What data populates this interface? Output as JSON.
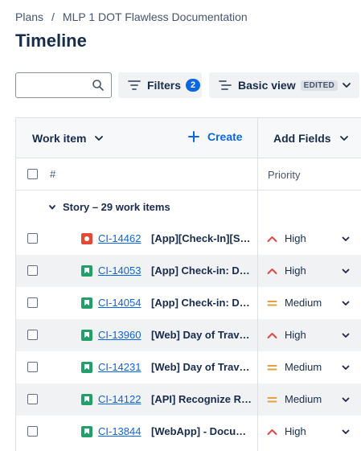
{
  "breadcrumb": {
    "root": "Plans",
    "separator": "/",
    "plan": "MLP 1 DOT Flawless Documentation"
  },
  "title": "Timeline",
  "toolbar": {
    "search_value": "",
    "filters_label": "Filters",
    "filters_count": "2",
    "view_label": "Basic view",
    "view_badge": "EDITED"
  },
  "grid": {
    "work_item_header": "Work item",
    "create_label": "Create",
    "add_fields_label": "Add Fields",
    "number_header": "#",
    "priority_header": "Priority",
    "group_label": "Story – 29 work items"
  },
  "rows": [
    {
      "type": "bug",
      "key": "CI-14462",
      "summary": "[App][Check-In][S…",
      "priority": "High"
    },
    {
      "type": "story",
      "key": "CI-14053",
      "summary": "[App] Check-in: D…",
      "priority": "High"
    },
    {
      "type": "story",
      "key": "CI-14054",
      "summary": "[App] Check-in: D…",
      "priority": "Medium"
    },
    {
      "type": "story",
      "key": "CI-13960",
      "summary": "[Web] Day of Trav…",
      "priority": "High"
    },
    {
      "type": "story",
      "key": "CI-14231",
      "summary": "[Web] Day of Trav…",
      "priority": "Medium"
    },
    {
      "type": "story",
      "key": "CI-14122",
      "summary": "[API] Recognize R…",
      "priority": "Medium"
    },
    {
      "type": "story",
      "key": "CI-13844",
      "summary": "[WebApp] - Docu…",
      "priority": "High"
    }
  ],
  "colors": {
    "high": "#e2483d",
    "medium": "#e2a03f",
    "accent": "#0c66e4",
    "story": "#22a06b",
    "bug": "#e34935"
  }
}
